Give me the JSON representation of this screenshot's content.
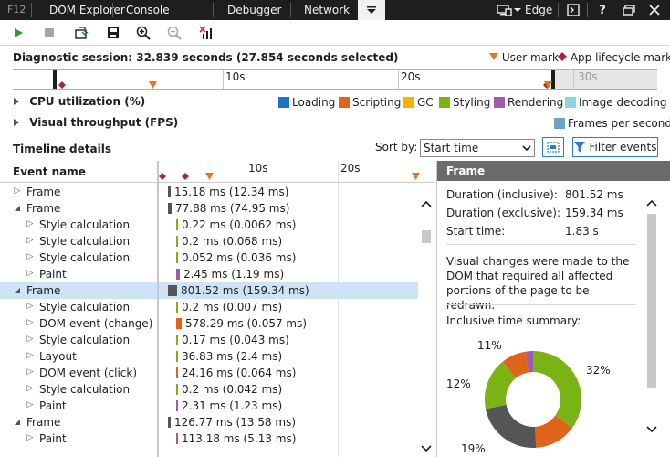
{
  "tabs": {
    "f12": "F12",
    "items": [
      "DOM Explorer",
      "Console",
      "Debugger",
      "Network"
    ],
    "browser": "Edge"
  },
  "session": {
    "title": "Diagnostic session: 32.839 seconds (27.854 seconds selected)",
    "user_mark": "User mark",
    "app_mark": "App lifecycle mark"
  },
  "ruler": {
    "labels": [
      "10s",
      "20s",
      "30s"
    ]
  },
  "swimlanes": {
    "cpu": "CPU utilization (%)",
    "visual": "Visual throughput (FPS)",
    "fps_legend": "Frames per second"
  },
  "categories": [
    {
      "label": "Loading",
      "color": "#1a73c8"
    },
    {
      "label": "Scripting",
      "color": "#e0631a"
    },
    {
      "label": "GC",
      "color": "#f5b400"
    },
    {
      "label": "Styling",
      "color": "#7ab313"
    },
    {
      "label": "Rendering",
      "color": "#a05ca8"
    },
    {
      "label": "Image decoding",
      "color": "#8dd3e6"
    }
  ],
  "timeline": {
    "title": "Timeline details",
    "sort_label": "Sort by:",
    "sort_value": "Start time",
    "filter_label": "Filter events",
    "col_event": "Event name",
    "ticks": [
      "10s",
      "20s"
    ]
  },
  "rows": [
    {
      "name": "Frame",
      "dur": "15.18 ms (12.34 ms)",
      "indent": 0,
      "expanded": false,
      "color": "#555555",
      "sel": false
    },
    {
      "name": "Frame",
      "dur": "77.88 ms (74.95 ms)",
      "indent": 0,
      "expanded": true,
      "color": "#555555",
      "sel": false
    },
    {
      "name": "Style calculation",
      "dur": "0.22 ms (0.0062 ms)",
      "indent": 1,
      "expanded": false,
      "color": "#7ab313",
      "sel": false
    },
    {
      "name": "Style calculation",
      "dur": "0.2 ms (0.068 ms)",
      "indent": 1,
      "expanded": false,
      "color": "#7ab313",
      "sel": false
    },
    {
      "name": "Style calculation",
      "dur": "0.052 ms (0.036 ms)",
      "indent": 1,
      "expanded": false,
      "color": "#7ab313",
      "sel": false
    },
    {
      "name": "Paint",
      "dur": "2.45 ms (1.19 ms)",
      "indent": 1,
      "expanded": false,
      "color": "#a05ca8",
      "sel": false
    },
    {
      "name": "Frame",
      "dur": "801.52 ms (159.34 ms)",
      "indent": 0,
      "expanded": true,
      "color": "#555555",
      "sel": true
    },
    {
      "name": "Style calculation",
      "dur": "0.2 ms (0.007 ms)",
      "indent": 1,
      "expanded": false,
      "color": "#7ab313",
      "sel": false
    },
    {
      "name": "DOM event (change)",
      "dur": "578.29 ms (0.057 ms)",
      "indent": 1,
      "expanded": false,
      "color": "#e0631a",
      "sel": false
    },
    {
      "name": "Style calculation",
      "dur": "0.17 ms (0.043 ms)",
      "indent": 1,
      "expanded": false,
      "color": "#7ab313",
      "sel": false
    },
    {
      "name": "Layout",
      "dur": "36.83 ms (2.4 ms)",
      "indent": 1,
      "expanded": false,
      "color": "#7ab313",
      "sel": false
    },
    {
      "name": "DOM event (click)",
      "dur": "24.16 ms (0.064 ms)",
      "indent": 1,
      "expanded": false,
      "color": "#e0631a",
      "sel": false
    },
    {
      "name": "Style calculation",
      "dur": "0.2 ms (0.042 ms)",
      "indent": 1,
      "expanded": false,
      "color": "#7ab313",
      "sel": false
    },
    {
      "name": "Paint",
      "dur": "2.31 ms (1.23 ms)",
      "indent": 1,
      "expanded": false,
      "color": "#a05ca8",
      "sel": false
    },
    {
      "name": "Frame",
      "dur": "126.77 ms (13.58 ms)",
      "indent": 0,
      "expanded": true,
      "color": "#555555",
      "sel": false
    },
    {
      "name": "Paint",
      "dur": "113.18 ms (5.13 ms)",
      "indent": 1,
      "expanded": false,
      "color": "#a05ca8",
      "sel": false
    }
  ],
  "details": {
    "header": "Frame",
    "incl_label": "Duration (inclusive):",
    "incl_value": "801.52 ms",
    "excl_label": "Duration (exclusive):",
    "excl_value": "159.34 ms",
    "start_label": "Start time:",
    "start_value": "1.83 s",
    "description": "Visual changes were made to the DOM that required all affected portions of the page to be redrawn.",
    "summary_label": "Inclusive time summary:",
    "pie_labels": [
      "32%",
      "11%",
      "12%",
      "19%"
    ]
  }
}
